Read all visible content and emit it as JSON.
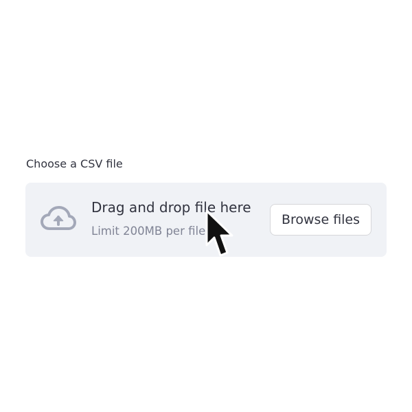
{
  "uploader": {
    "label": "Choose a CSV file",
    "drop_title": "Drag and drop file here",
    "limit_text": "Limit 200MB per file",
    "browse_label": "Browse files",
    "icon": "cloud-upload-icon"
  },
  "cursor": {
    "icon": "mouse-pointer-icon"
  },
  "colors": {
    "dropzone_bg": "#f0f2f6",
    "text": "#31333f",
    "muted_text": "#808495",
    "icon": "#a3a8b8",
    "button_border": "#d6d6d9"
  }
}
